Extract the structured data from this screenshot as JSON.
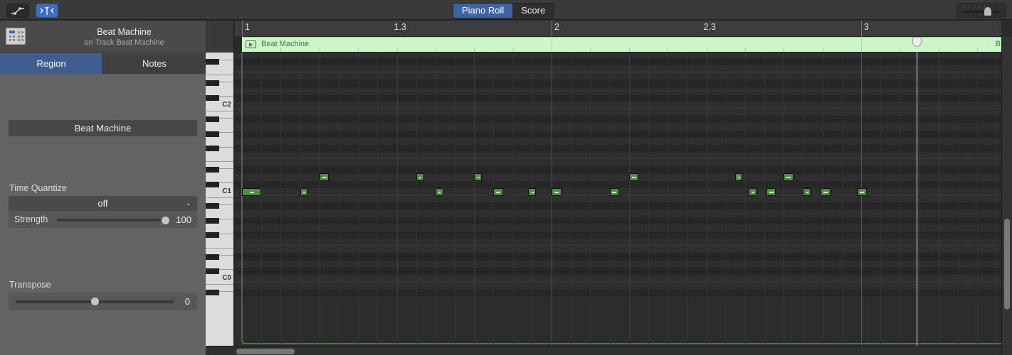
{
  "toolbar": {
    "automation_icon": "automation-curve-icon",
    "catch_icon": "catch-playhead-icon",
    "view_tabs": [
      {
        "label": "Piano Roll",
        "active": true
      },
      {
        "label": "Score",
        "active": false
      }
    ],
    "zoom_slider_value": 0.7
  },
  "inspector": {
    "instrument_icon": "drum-machine-icon",
    "title": "Beat Machine",
    "subtitle": "on Track Beat Machine",
    "tabs": [
      {
        "label": "Region",
        "active": true
      },
      {
        "label": "Notes",
        "active": false
      }
    ],
    "region_name": "Beat Machine",
    "time_quantize": {
      "label": "Time Quantize",
      "value": "off",
      "strength_label": "Strength",
      "strength_value": "100"
    },
    "transpose": {
      "label": "Transpose",
      "value": "0",
      "slider_fraction": 0.5
    }
  },
  "keyboard": {
    "labels": [
      "C2",
      "C1",
      "C0"
    ]
  },
  "ruler": {
    "marks": [
      "1",
      "1.3",
      "2",
      "2.3",
      "3"
    ]
  },
  "region": {
    "name": "Beat Machine",
    "continuation_label": "B"
  },
  "playhead": {
    "position_bars": 3.18
  },
  "notes": {
    "unit": "sixteenths from bar 1",
    "items": [
      {
        "pitch": "C1",
        "start": 0,
        "length": 1
      },
      {
        "pitch": "C1",
        "start": 3,
        "length": 0.4
      },
      {
        "pitch": "D1",
        "start": 4,
        "length": 0.5
      },
      {
        "pitch": "D1",
        "start": 9,
        "length": 0.4
      },
      {
        "pitch": "C1",
        "start": 10,
        "length": 0.4
      },
      {
        "pitch": "D1",
        "start": 12,
        "length": 0.4
      },
      {
        "pitch": "C1",
        "start": 13,
        "length": 0.5
      },
      {
        "pitch": "C1",
        "start": 14.8,
        "length": 0.4
      },
      {
        "pitch": "C1",
        "start": 16,
        "length": 0.5
      },
      {
        "pitch": "C1",
        "start": 19,
        "length": 0.5
      },
      {
        "pitch": "D1",
        "start": 20,
        "length": 0.5
      },
      {
        "pitch": "D1",
        "start": 25.5,
        "length": 0.3
      },
      {
        "pitch": "C1",
        "start": 26.2,
        "length": 0.4
      },
      {
        "pitch": "C1",
        "start": 27.1,
        "length": 0.5
      },
      {
        "pitch": "D1",
        "start": 28,
        "length": 0.5
      },
      {
        "pitch": "C1",
        "start": 29,
        "length": 0.4
      },
      {
        "pitch": "C1",
        "start": 29.9,
        "length": 0.5
      },
      {
        "pitch": "C1",
        "start": 31.8,
        "length": 0.5
      }
    ]
  },
  "colors": {
    "accent_blue": "#3e63a5",
    "region_green": "#cdf7c8",
    "note_green": "#4f8d45"
  }
}
